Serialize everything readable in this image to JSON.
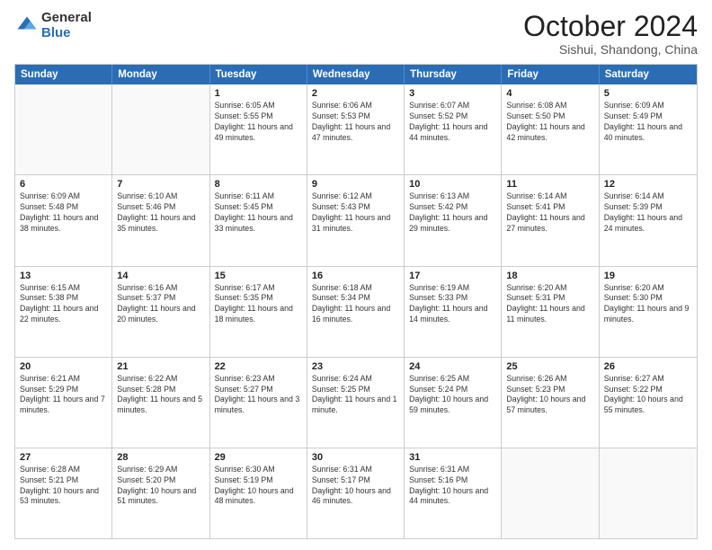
{
  "logo": {
    "general": "General",
    "blue": "Blue"
  },
  "title": {
    "month": "October 2024",
    "location": "Sishui, Shandong, China"
  },
  "header_days": [
    "Sunday",
    "Monday",
    "Tuesday",
    "Wednesday",
    "Thursday",
    "Friday",
    "Saturday"
  ],
  "rows": [
    [
      {
        "day": "",
        "text": "",
        "empty": true
      },
      {
        "day": "",
        "text": "",
        "empty": true
      },
      {
        "day": "1",
        "text": "Sunrise: 6:05 AM\nSunset: 5:55 PM\nDaylight: 11 hours and 49 minutes."
      },
      {
        "day": "2",
        "text": "Sunrise: 6:06 AM\nSunset: 5:53 PM\nDaylight: 11 hours and 47 minutes."
      },
      {
        "day": "3",
        "text": "Sunrise: 6:07 AM\nSunset: 5:52 PM\nDaylight: 11 hours and 44 minutes."
      },
      {
        "day": "4",
        "text": "Sunrise: 6:08 AM\nSunset: 5:50 PM\nDaylight: 11 hours and 42 minutes."
      },
      {
        "day": "5",
        "text": "Sunrise: 6:09 AM\nSunset: 5:49 PM\nDaylight: 11 hours and 40 minutes."
      }
    ],
    [
      {
        "day": "6",
        "text": "Sunrise: 6:09 AM\nSunset: 5:48 PM\nDaylight: 11 hours and 38 minutes."
      },
      {
        "day": "7",
        "text": "Sunrise: 6:10 AM\nSunset: 5:46 PM\nDaylight: 11 hours and 35 minutes."
      },
      {
        "day": "8",
        "text": "Sunrise: 6:11 AM\nSunset: 5:45 PM\nDaylight: 11 hours and 33 minutes."
      },
      {
        "day": "9",
        "text": "Sunrise: 6:12 AM\nSunset: 5:43 PM\nDaylight: 11 hours and 31 minutes."
      },
      {
        "day": "10",
        "text": "Sunrise: 6:13 AM\nSunset: 5:42 PM\nDaylight: 11 hours and 29 minutes."
      },
      {
        "day": "11",
        "text": "Sunrise: 6:14 AM\nSunset: 5:41 PM\nDaylight: 11 hours and 27 minutes."
      },
      {
        "day": "12",
        "text": "Sunrise: 6:14 AM\nSunset: 5:39 PM\nDaylight: 11 hours and 24 minutes."
      }
    ],
    [
      {
        "day": "13",
        "text": "Sunrise: 6:15 AM\nSunset: 5:38 PM\nDaylight: 11 hours and 22 minutes."
      },
      {
        "day": "14",
        "text": "Sunrise: 6:16 AM\nSunset: 5:37 PM\nDaylight: 11 hours and 20 minutes."
      },
      {
        "day": "15",
        "text": "Sunrise: 6:17 AM\nSunset: 5:35 PM\nDaylight: 11 hours and 18 minutes."
      },
      {
        "day": "16",
        "text": "Sunrise: 6:18 AM\nSunset: 5:34 PM\nDaylight: 11 hours and 16 minutes."
      },
      {
        "day": "17",
        "text": "Sunrise: 6:19 AM\nSunset: 5:33 PM\nDaylight: 11 hours and 14 minutes."
      },
      {
        "day": "18",
        "text": "Sunrise: 6:20 AM\nSunset: 5:31 PM\nDaylight: 11 hours and 11 minutes."
      },
      {
        "day": "19",
        "text": "Sunrise: 6:20 AM\nSunset: 5:30 PM\nDaylight: 11 hours and 9 minutes."
      }
    ],
    [
      {
        "day": "20",
        "text": "Sunrise: 6:21 AM\nSunset: 5:29 PM\nDaylight: 11 hours and 7 minutes."
      },
      {
        "day": "21",
        "text": "Sunrise: 6:22 AM\nSunset: 5:28 PM\nDaylight: 11 hours and 5 minutes."
      },
      {
        "day": "22",
        "text": "Sunrise: 6:23 AM\nSunset: 5:27 PM\nDaylight: 11 hours and 3 minutes."
      },
      {
        "day": "23",
        "text": "Sunrise: 6:24 AM\nSunset: 5:25 PM\nDaylight: 11 hours and 1 minute."
      },
      {
        "day": "24",
        "text": "Sunrise: 6:25 AM\nSunset: 5:24 PM\nDaylight: 10 hours and 59 minutes."
      },
      {
        "day": "25",
        "text": "Sunrise: 6:26 AM\nSunset: 5:23 PM\nDaylight: 10 hours and 57 minutes."
      },
      {
        "day": "26",
        "text": "Sunrise: 6:27 AM\nSunset: 5:22 PM\nDaylight: 10 hours and 55 minutes."
      }
    ],
    [
      {
        "day": "27",
        "text": "Sunrise: 6:28 AM\nSunset: 5:21 PM\nDaylight: 10 hours and 53 minutes."
      },
      {
        "day": "28",
        "text": "Sunrise: 6:29 AM\nSunset: 5:20 PM\nDaylight: 10 hours and 51 minutes."
      },
      {
        "day": "29",
        "text": "Sunrise: 6:30 AM\nSunset: 5:19 PM\nDaylight: 10 hours and 48 minutes."
      },
      {
        "day": "30",
        "text": "Sunrise: 6:31 AM\nSunset: 5:17 PM\nDaylight: 10 hours and 46 minutes."
      },
      {
        "day": "31",
        "text": "Sunrise: 6:31 AM\nSunset: 5:16 PM\nDaylight: 10 hours and 44 minutes."
      },
      {
        "day": "",
        "text": "",
        "empty": true
      },
      {
        "day": "",
        "text": "",
        "empty": true
      }
    ]
  ]
}
